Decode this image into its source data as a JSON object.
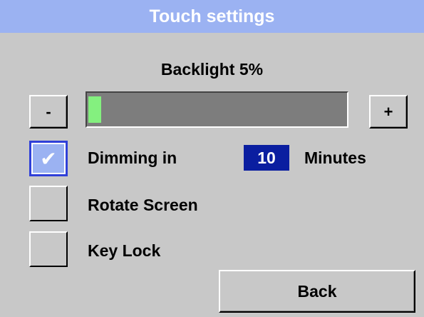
{
  "title": "Touch settings",
  "backlight": {
    "label": "Backlight 5%",
    "level_percent": 5,
    "fill_color": "#84f07f",
    "decrease_label": "-",
    "increase_label": "+"
  },
  "dimming": {
    "checked": true,
    "check_glyph": "✔",
    "label": "Dimming in",
    "value": "10",
    "units": "Minutes"
  },
  "rotate_screen": {
    "checked": false,
    "label": "Rotate Screen"
  },
  "key_lock": {
    "checked": false,
    "label": "Key Lock"
  },
  "back_label": "Back",
  "colors": {
    "title_bar": "#9bb2f2",
    "background": "#c8c8c8",
    "value_box": "#0a1ea0"
  }
}
